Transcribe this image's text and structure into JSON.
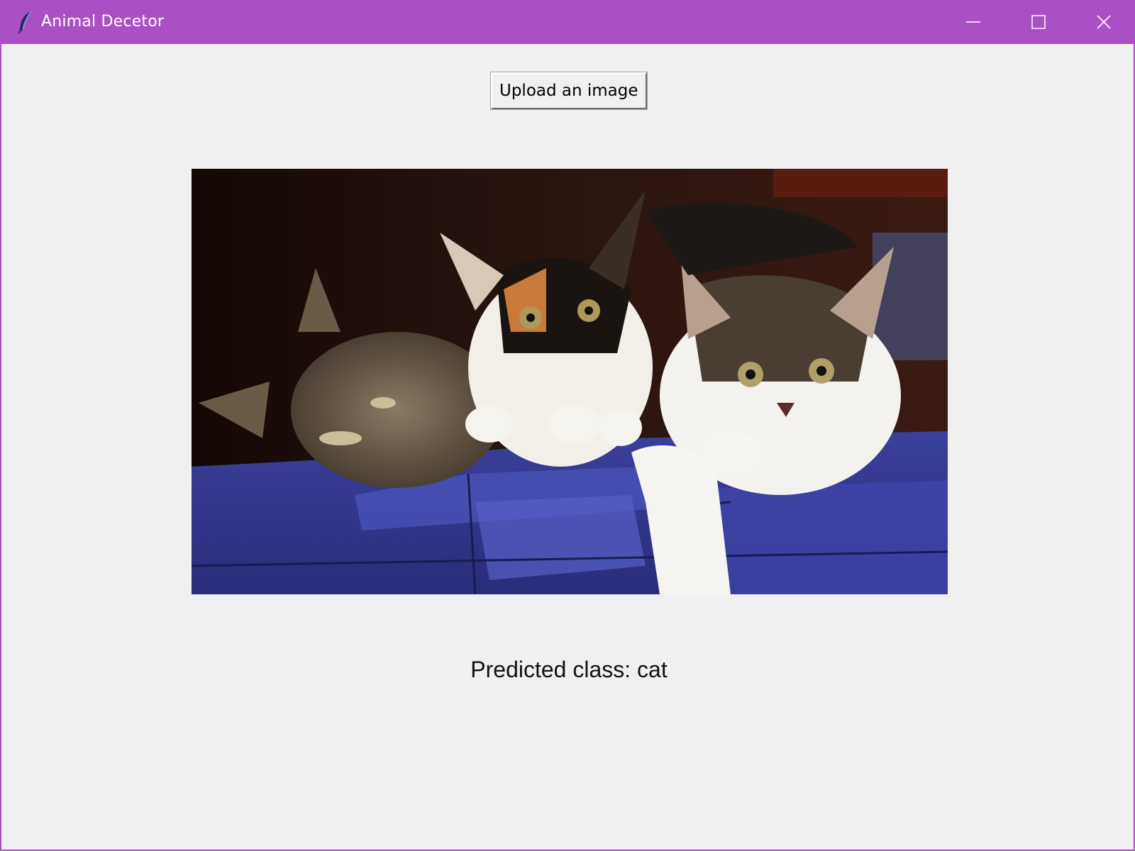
{
  "window": {
    "title": "Animal Decetor",
    "accent_color": "#ab4fc4",
    "app_icon": "feather-icon",
    "controls": {
      "minimize": "minimize-icon",
      "maximize": "maximize-icon",
      "close": "close-icon"
    }
  },
  "main": {
    "upload_button_label": "Upload an image",
    "image": {
      "subject": "three kittens lying on a blue blanket"
    },
    "prediction_text": "Predicted class: cat"
  }
}
